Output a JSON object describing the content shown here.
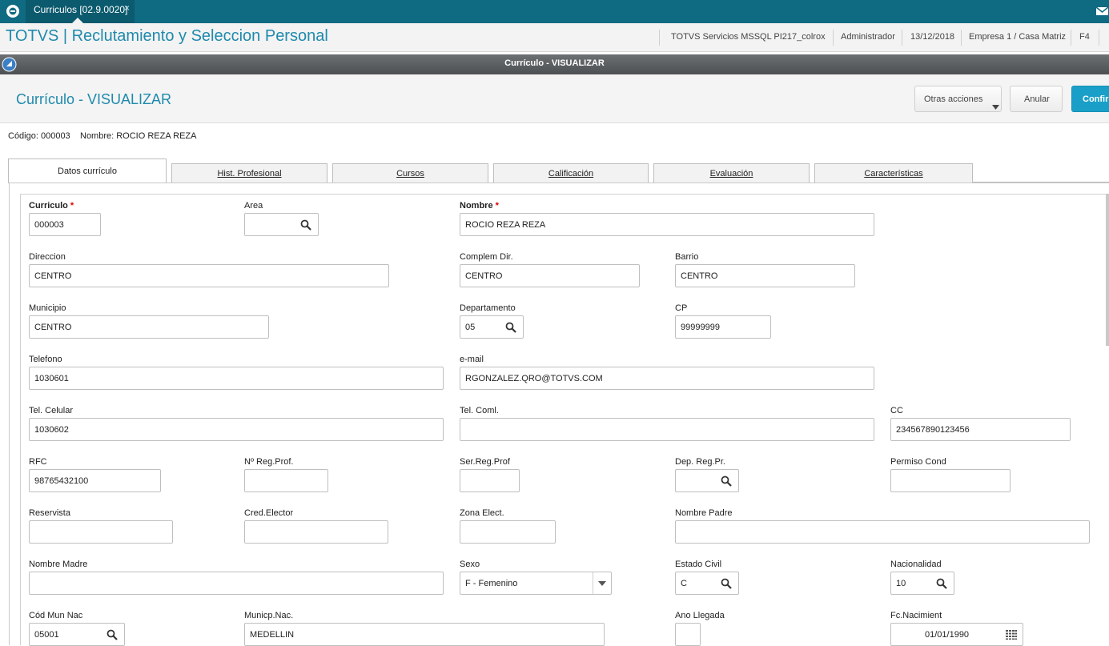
{
  "topbar": {
    "tab_label": "Curriculos [02.9.0020]",
    "tab_close": "×"
  },
  "header": {
    "title": "TOTVS | Reclutamiento y Seleccion Personal",
    "server": "TOTVS Servicios MSSQL PI217_colrox",
    "user": "Administrador",
    "date": "13/12/2018",
    "company": "Empresa 1 / Casa Matriz",
    "key": "F4"
  },
  "window_title": "Currículo - VISUALIZAR",
  "page_title": "Currículo - VISUALIZAR",
  "actions": {
    "other": "Otras acciones",
    "cancel": "Anular",
    "confirm": "Confir"
  },
  "record": {
    "code": "Código: 000003",
    "name": "Nombre: ROCIO REZA REZA"
  },
  "tabs": [
    "Datos currículo",
    "Hist. Profesional",
    "Cursos",
    "Calificación",
    "Evaluación",
    "Características"
  ],
  "form": {
    "curriculo": {
      "label": "Curriculo",
      "req": "*",
      "value": "000003"
    },
    "area": {
      "label": "Area",
      "value": ""
    },
    "nombre": {
      "label": "Nombre",
      "req": "*",
      "value": "ROCIO REZA REZA"
    },
    "direccion": {
      "label": "Direccion",
      "value": "CENTRO"
    },
    "complem": {
      "label": "Complem Dir.",
      "value": "CENTRO"
    },
    "barrio": {
      "label": "Barrio",
      "value": "CENTRO"
    },
    "municipio": {
      "label": "Municipio",
      "value": "CENTRO"
    },
    "departamento": {
      "label": "Departamento",
      "value": "05"
    },
    "cp": {
      "label": "CP",
      "value": "99999999"
    },
    "telefono": {
      "label": "Telefono",
      "value": "1030601"
    },
    "email": {
      "label": "e-mail",
      "value": "RGONZALEZ.QRO@TOTVS.COM"
    },
    "celular": {
      "label": "Tel. Celular",
      "value": "1030602"
    },
    "telcoml": {
      "label": "Tel. Coml.",
      "value": ""
    },
    "cc": {
      "label": "CC",
      "value": "234567890123456"
    },
    "rfc": {
      "label": "RFC",
      "value": "98765432100"
    },
    "regprof": {
      "label": "Nº Reg.Prof.",
      "value": ""
    },
    "serreg": {
      "label": "Ser.Reg.Prof",
      "value": ""
    },
    "depreg": {
      "label": "Dep. Reg.Pr.",
      "value": ""
    },
    "permiso": {
      "label": "Permiso Cond",
      "value": ""
    },
    "reservista": {
      "label": "Reservista",
      "value": ""
    },
    "credelector": {
      "label": "Cred.Elector",
      "value": ""
    },
    "zonaelect": {
      "label": "Zona Elect.",
      "value": ""
    },
    "padre": {
      "label": "Nombre Padre",
      "value": ""
    },
    "madre": {
      "label": "Nombre Madre",
      "value": ""
    },
    "sexo": {
      "label": "Sexo",
      "value": "F - Femenino"
    },
    "estadocivil": {
      "label": "Estado Civil",
      "value": "C"
    },
    "nacionalidad": {
      "label": "Nacionalidad",
      "value": "10"
    },
    "codmun": {
      "label": "Cód Mun Nac",
      "value": "05001"
    },
    "municpnac": {
      "label": "Municp.Nac.",
      "value": "MEDELLIN"
    },
    "anollegada": {
      "label": "Ano Llegada",
      "value": ""
    },
    "fcnac": {
      "label": "Fc.Nacimient",
      "value": "01/01/1990"
    }
  },
  "colors": {
    "accent": "#1f8aad",
    "topbar": "#0f6b82",
    "confirm": "#1aa0c8"
  }
}
